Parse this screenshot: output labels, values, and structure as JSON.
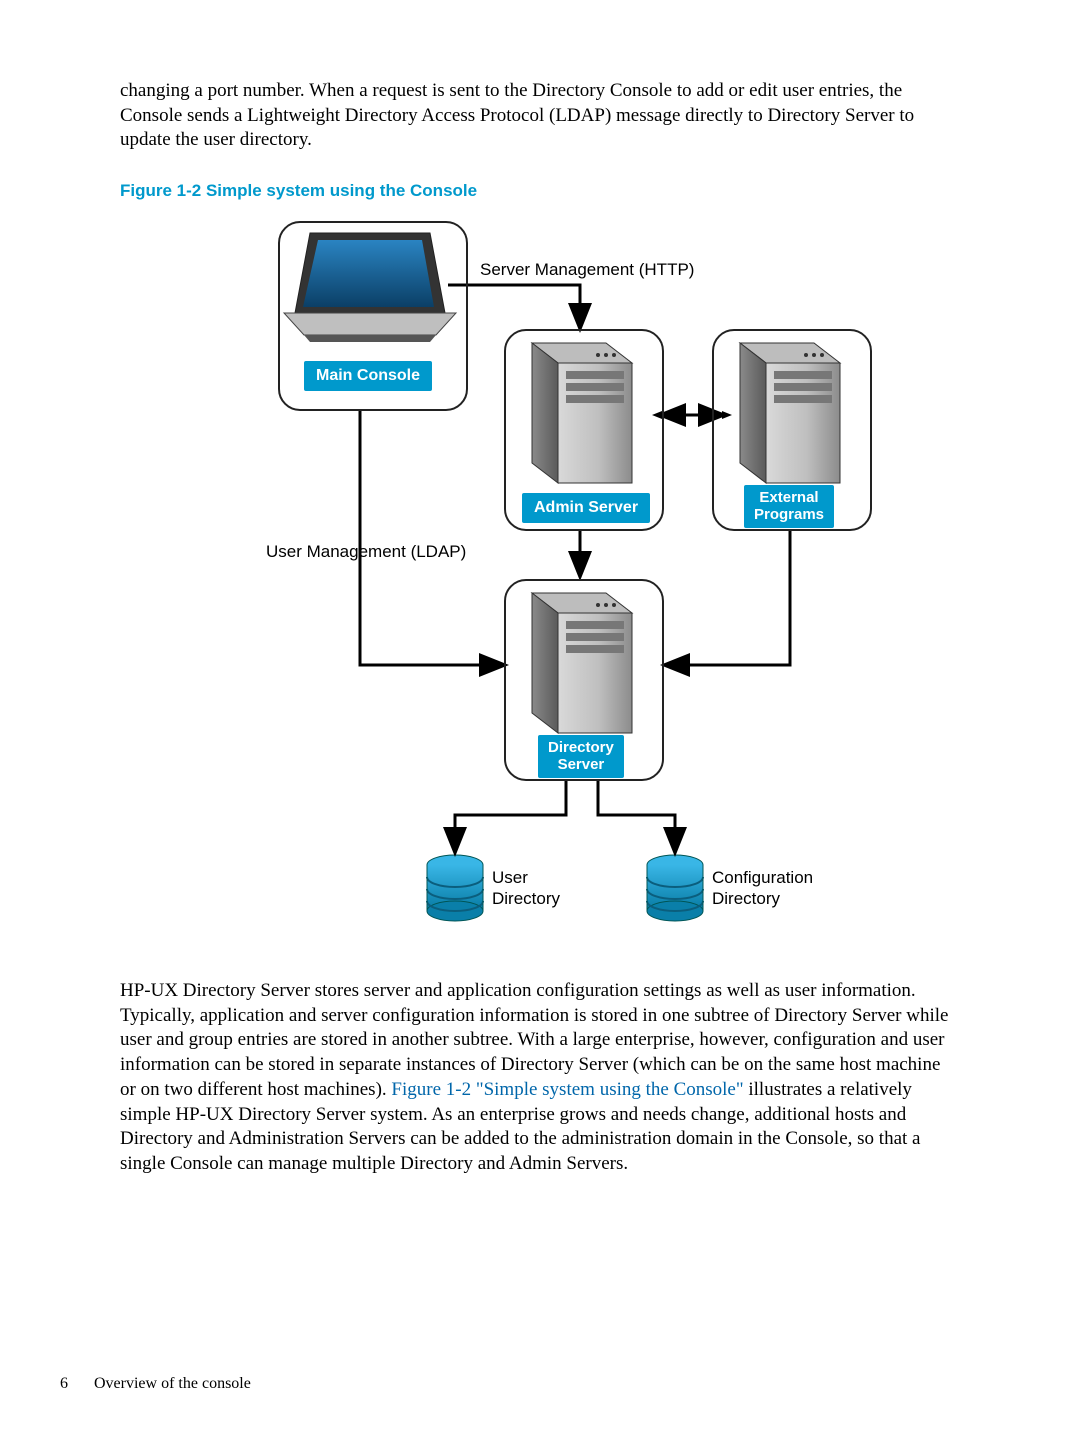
{
  "top_paragraph": "changing a port number. When a request is sent to the Directory Console to add or edit user entries, the Console sends a Lightweight Directory Access Protocol (LDAP) message directly to Directory Server to update the user directory.",
  "figure_caption": "Figure 1-2 Simple system using the Console",
  "diagram": {
    "label_server_mgmt": "Server Management (HTTP)",
    "label_user_mgmt": "User Management (LDAP)",
    "chip_main_console": "Main Console",
    "chip_admin_server": "Admin Server",
    "chip_external_programs_l1": "External",
    "chip_external_programs_l2": "Programs",
    "chip_directory_server_l1": "Directory",
    "chip_directory_server_l2": "Server",
    "label_user_dir_l1": "User",
    "label_user_dir_l2": "Directory",
    "label_config_dir_l1": "Configuration",
    "label_config_dir_l2": "Directory"
  },
  "bottom_paragraph_1": "HP-UX Directory Server stores server and application configuration settings as well as user information. Typically, application and server configuration information is stored in one subtree of Directory Server while user and group entries are stored in another subtree. With a large enterprise, however, configuration and user information can be stored in separate instances of Directory Server (which can be on the same host machine or on two different host machines). ",
  "bottom_paragraph_link": "Figure 1-2 \"Simple system using the Console\"",
  "bottom_paragraph_2": " illustrates a relatively simple HP-UX Directory Server system. As an enterprise grows and needs change, additional hosts and Directory and Administration Servers can be added to the administration domain in the Console, so that a single Console can manage multiple Directory and Admin Servers.",
  "footer_page": "6",
  "footer_text": "Overview of the console"
}
